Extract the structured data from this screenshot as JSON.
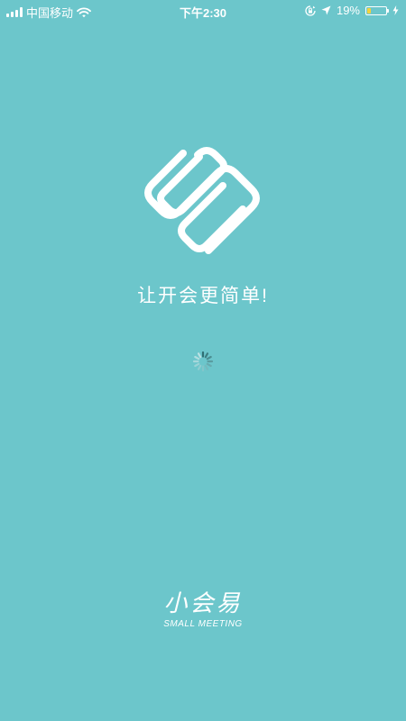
{
  "status_bar": {
    "carrier": "中国移动",
    "time": "下午2:30",
    "battery_percent": "19%",
    "battery_level": 0.19,
    "icons": [
      "signal-icon",
      "wifi-icon",
      "orientation-lock-icon",
      "location-arrow-icon",
      "battery-icon",
      "charging-icon"
    ]
  },
  "splash": {
    "tagline": "让开会更简单!",
    "logo_icon": "paperclip-logo-icon",
    "loading_icon": "spinner-icon"
  },
  "brand": {
    "name": "小会易",
    "subtitle": "SMALL MEETING"
  },
  "colors": {
    "background": "#6cc6cb",
    "foreground": "#ffffff",
    "battery_fill": "#f4d23c"
  }
}
